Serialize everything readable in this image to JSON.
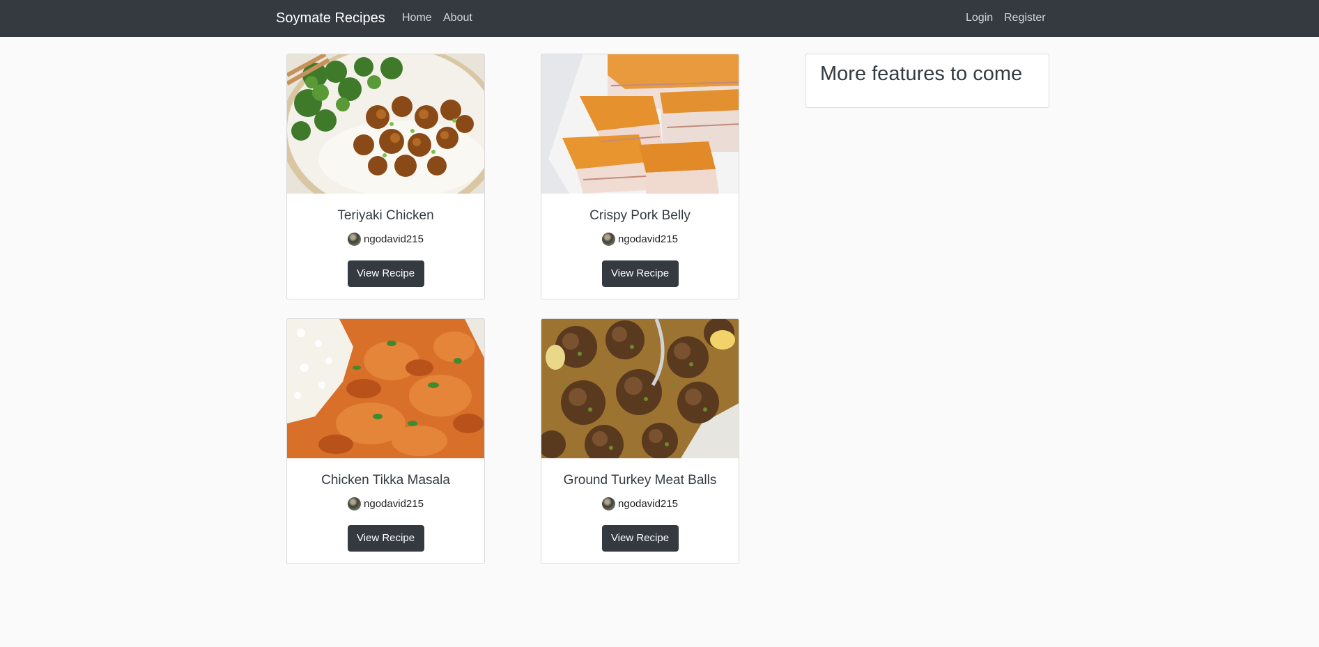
{
  "navbar": {
    "brand": "Soymate Recipes",
    "links": [
      "Home",
      "About"
    ],
    "right_links": [
      "Login",
      "Register"
    ]
  },
  "recipes": [
    {
      "title": "Teriyaki Chicken",
      "author": "ngodavid215",
      "button": "View Recipe",
      "image": "teriyaki-chicken-photo"
    },
    {
      "title": "Crispy Pork Belly",
      "author": "ngodavid215",
      "button": "View Recipe",
      "image": "crispy-pork-belly-photo"
    },
    {
      "title": "Chicken Tikka Masala",
      "author": "ngodavid215",
      "button": "View Recipe",
      "image": "chicken-tikka-masala-photo"
    },
    {
      "title": "Ground Turkey Meat Balls",
      "author": "ngodavid215",
      "button": "View Recipe",
      "image": "turkey-meatballs-photo"
    }
  ],
  "sidebar": {
    "title": "More features to come"
  },
  "colors": {
    "navbar": "#343a40",
    "button": "#343a40",
    "background": "#fafafa"
  }
}
